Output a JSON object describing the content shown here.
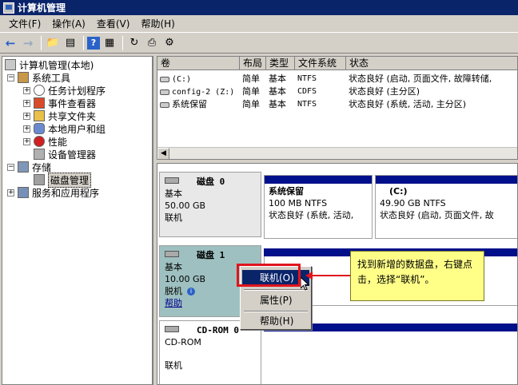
{
  "window": {
    "title": "计算机管理"
  },
  "menubar": {
    "items": [
      "文件(F)",
      "操作(A)",
      "查看(V)",
      "帮助(H)"
    ]
  },
  "toolbar": {
    "icons": [
      "back-arrow-icon",
      "forward-arrow-icon",
      "up-folder-icon",
      "show-hide-tree-icon",
      "help-icon",
      "properties-pane-icon",
      "refresh-icon",
      "export-icon",
      "settings-icon"
    ]
  },
  "tree": {
    "root": "计算机管理(本地)",
    "items": [
      {
        "label": "系统工具"
      },
      {
        "label": "任务计划程序"
      },
      {
        "label": "事件查看器"
      },
      {
        "label": "共享文件夹"
      },
      {
        "label": "本地用户和组"
      },
      {
        "label": "性能"
      },
      {
        "label": "设备管理器"
      },
      {
        "label": "存储"
      },
      {
        "label": "磁盘管理"
      },
      {
        "label": "服务和应用程序"
      }
    ]
  },
  "volumes": {
    "headers": [
      "卷",
      "布局",
      "类型",
      "文件系统",
      "状态"
    ],
    "rows": [
      {
        "name": "(C:)",
        "layout": "简单",
        "type": "基本",
        "fs": "NTFS",
        "status": "状态良好 (启动, 页面文件, 故障转储,"
      },
      {
        "name": "config-2 (Z:)",
        "layout": "简单",
        "type": "基本",
        "fs": "CDFS",
        "status": "状态良好 (主分区)"
      },
      {
        "name": "系统保留",
        "layout": "简单",
        "type": "基本",
        "fs": "NTFS",
        "status": "状态良好 (系统, 活动, 主分区)"
      }
    ]
  },
  "disks": {
    "disk0": {
      "name": "磁盘 0",
      "type": "基本",
      "size": "50.00 GB",
      "state": "联机"
    },
    "disk0_partitions": [
      {
        "title": "系统保留",
        "size": "100 MB NTFS",
        "status": "状态良好 (系统, 活动,"
      },
      {
        "title": "(C:)",
        "size": "49.90 GB NTFS",
        "status": "状态良好 (启动, 页面文件, 故"
      }
    ],
    "disk1": {
      "name": "磁盘 1",
      "type": "基本",
      "size": "10.00 GB",
      "state": "脱机",
      "help": "帮助"
    },
    "cdrom": {
      "name": "CD-ROM 0",
      "type": "CD-ROM",
      "state": "联机"
    }
  },
  "context_menu": {
    "items": [
      "联机(O)",
      "属性(P)",
      "帮助(H)"
    ]
  },
  "callout": {
    "text": "找到新增的数据盘，右键点击，选择“联机”。"
  }
}
